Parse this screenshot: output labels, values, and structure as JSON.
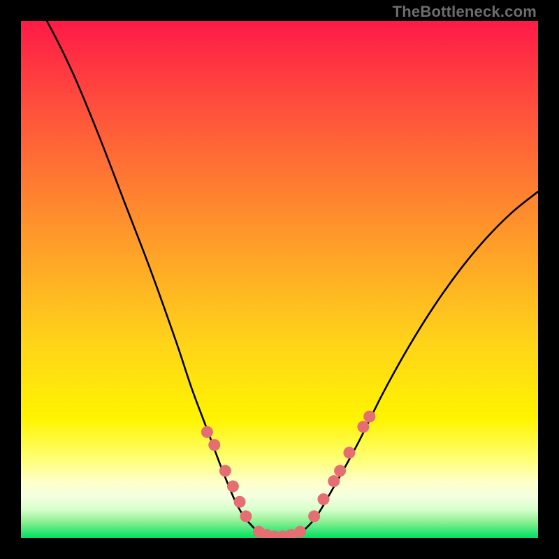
{
  "watermark": "TheBottleneck.com",
  "colors": {
    "frame": "#000000",
    "curve": "#000000",
    "dot_fill": "#e46e72",
    "dot_stroke": "#d85a5f",
    "grad_top": "#ff1a47",
    "grad_mid1": "#ff8a2a",
    "grad_mid2": "#fff200",
    "grad_band1": "#ffff9e",
    "grad_band2": "#fbffd0",
    "grad_band3": "#d4ffc0",
    "grad_bottom": "#00e060"
  },
  "chart_data": {
    "type": "line",
    "title": "",
    "xlabel": "",
    "ylabel": "",
    "xlim": [
      0,
      100
    ],
    "ylim": [
      0,
      100
    ],
    "series": [
      {
        "name": "bottleneck-curve",
        "x": [
          0,
          5,
          10,
          15,
          20,
          25,
          30,
          33,
          36,
          39,
          42,
          45,
          48,
          51,
          54,
          57,
          60,
          65,
          70,
          75,
          80,
          85,
          90,
          95,
          100
        ],
        "y": [
          108,
          100,
          90,
          78,
          65,
          52,
          38,
          29,
          21,
          13,
          6,
          2,
          0,
          0,
          1,
          4,
          9,
          18,
          28,
          37,
          45,
          52,
          58,
          63,
          67
        ]
      }
    ],
    "markers": {
      "name": "highlight-dots",
      "points": [
        {
          "x": 36.0,
          "y": 20.5
        },
        {
          "x": 37.4,
          "y": 18.0
        },
        {
          "x": 39.5,
          "y": 13.0
        },
        {
          "x": 41.0,
          "y": 10.0
        },
        {
          "x": 42.3,
          "y": 7.0
        },
        {
          "x": 43.5,
          "y": 4.2
        },
        {
          "x": 46.0,
          "y": 1.2
        },
        {
          "x": 47.5,
          "y": 0.6
        },
        {
          "x": 49.0,
          "y": 0.3
        },
        {
          "x": 50.6,
          "y": 0.3
        },
        {
          "x": 52.3,
          "y": 0.6
        },
        {
          "x": 54.0,
          "y": 1.2
        },
        {
          "x": 56.7,
          "y": 4.2
        },
        {
          "x": 58.5,
          "y": 7.5
        },
        {
          "x": 60.5,
          "y": 11.0
        },
        {
          "x": 61.7,
          "y": 13.0
        },
        {
          "x": 63.5,
          "y": 16.5
        },
        {
          "x": 66.2,
          "y": 21.5
        },
        {
          "x": 67.4,
          "y": 23.5
        }
      ]
    }
  }
}
